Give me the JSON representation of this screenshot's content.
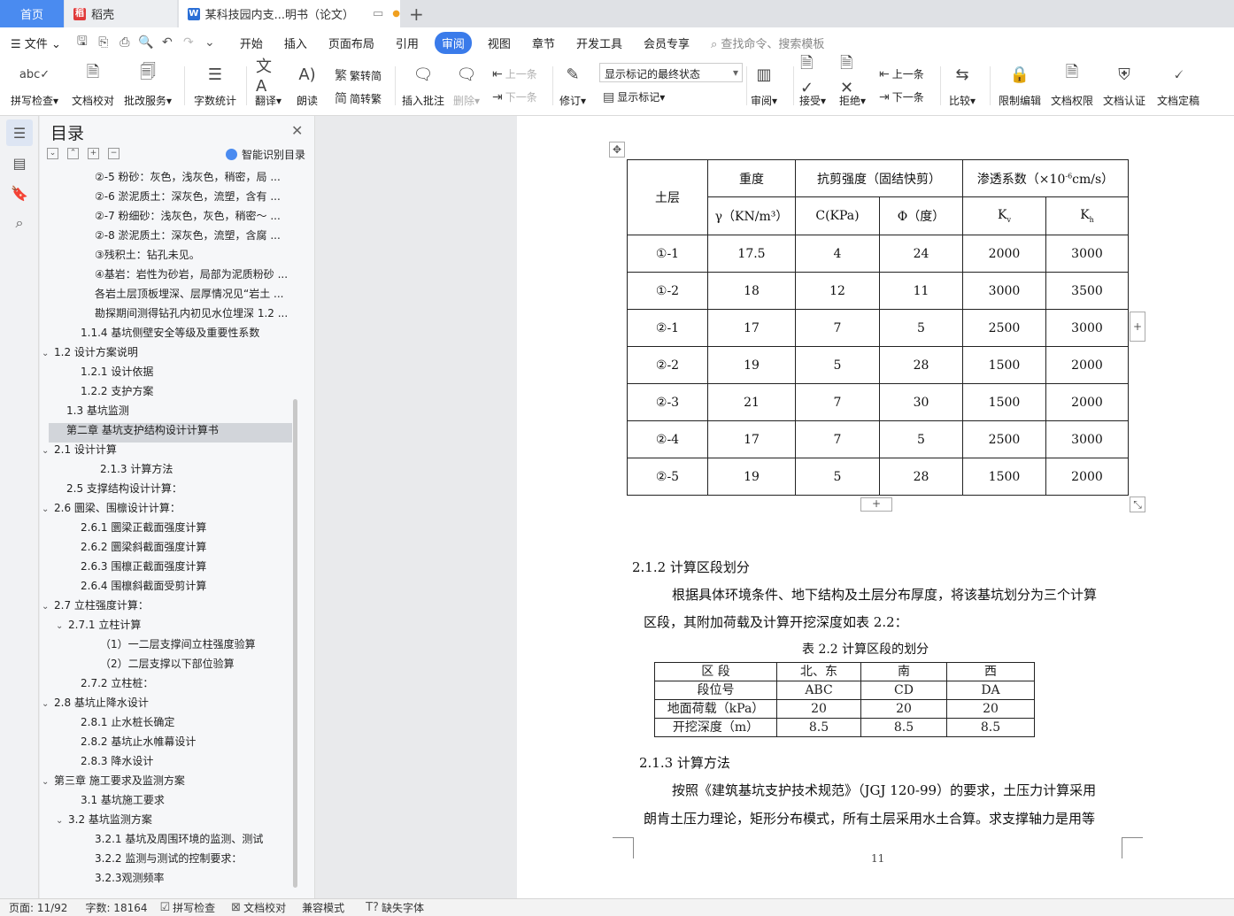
{
  "tabs": {
    "home": "首页",
    "daoke": "稻壳",
    "doc": "某科技园内支...明书（论文）"
  },
  "menubar": {
    "file": "文件",
    "items": [
      "开始",
      "插入",
      "页面布局",
      "引用",
      "审阅",
      "视图",
      "章节",
      "开发工具",
      "会员专享"
    ],
    "active": "审阅",
    "search": "查找命令、搜索模板"
  },
  "ribbon": {
    "spell": "拼写检查",
    "proof": "文档校对",
    "batch": "批改服务",
    "wordcount": "字数统计",
    "translate": "翻译",
    "read": "朗读",
    "t2s": "繁转简",
    "s2t": "简转繁",
    "insert_comment": "插入批注",
    "delete": "删除",
    "prev_comment": "上一条",
    "next_comment": "下一条",
    "revise": "修订",
    "mark_state": "显示标记的最终状态",
    "show_marks": "显示标记",
    "review": "审阅",
    "accept": "接受",
    "reject": "拒绝",
    "prev": "上一条",
    "next": "下一条",
    "compare": "比较",
    "restrict": "限制编辑",
    "rights": "文档权限",
    "auth": "文档认证",
    "finalize": "文档定稿"
  },
  "toc": {
    "title": "目录",
    "smart": "智能识别目录",
    "items": [
      {
        "text": "②-5 粉砂：灰色，浅灰色，稍密，局 ...",
        "caret": ""
      },
      {
        "text": "②-6 淤泥质土：深灰色，流塑，含有 ...",
        "caret": ""
      },
      {
        "text": "②-7 粉细砂：浅灰色，灰色，稍密～ ...",
        "caret": ""
      },
      {
        "text": "②-8 淤泥质土：深灰色，流塑，含腐 ...",
        "caret": ""
      },
      {
        "text": "③残积土：钻孔未见。",
        "caret": ""
      },
      {
        "text": "④基岩：岩性为砂岩，局部为泥质粉砂 ...",
        "caret": ""
      },
      {
        "text": "各岩土层顶板埋深、层厚情况见“岩土 ...",
        "caret": ""
      },
      {
        "text": "勘探期间测得钻孔内初见水位埋深 1.2 ...",
        "caret": ""
      },
      {
        "text": "1.1.4  基坑侧壁安全等级及重要性系数",
        "caret": ""
      },
      {
        "text": "1.2  设计方案说明",
        "caret": "v"
      },
      {
        "text": "1.2.1  设计依据",
        "caret": ""
      },
      {
        "text": "1.2.2  支护方案",
        "caret": ""
      },
      {
        "text": "1.3  基坑监测",
        "caret": ""
      },
      {
        "text": "第二章  基坑支护结构设计计算书",
        "caret": ""
      },
      {
        "text": "2.1  设计计算",
        "caret": "v"
      },
      {
        "text": "2.1.3 计算方法",
        "caret": ""
      },
      {
        "text": "2.5 支撑结构设计计算：",
        "caret": ""
      },
      {
        "text": "2.6 圜梁、围檩设计计算：",
        "caret": "v"
      },
      {
        "text": "2.6.1  圜梁正截面强度计算",
        "caret": ""
      },
      {
        "text": "2.6.2  圜梁斜截面强度计算",
        "caret": ""
      },
      {
        "text": "2.6.3  围檩正截面强度计算",
        "caret": ""
      },
      {
        "text": "2.6.4 围檩斜截面受剪计算",
        "caret": ""
      },
      {
        "text": "2.7 立柱强度计算：",
        "caret": "v"
      },
      {
        "text": "2.7.1 立柱计算",
        "caret": "v"
      },
      {
        "text": "（1）一二层支撑间立柱强度验算",
        "caret": ""
      },
      {
        "text": "（2）二层支撑以下部位验算",
        "caret": ""
      },
      {
        "text": "2.7.2 立柱桩：",
        "caret": ""
      },
      {
        "text": "2.8  基坑止降水设计",
        "caret": "v"
      },
      {
        "text": "2.8.1 止水桩长确定",
        "caret": ""
      },
      {
        "text": "2.8.2 基坑止水帷幕设计",
        "caret": ""
      },
      {
        "text": "2.8.3 降水设计",
        "caret": ""
      },
      {
        "text": "第三章    施工要求及监测方案",
        "caret": "v"
      },
      {
        "text": "3.1    基坑施工要求",
        "caret": ""
      },
      {
        "text": "3.2    基坑监测方案",
        "caret": "v"
      },
      {
        "text": "3.2.1 基坑及周围环境的监测、测试",
        "caret": ""
      },
      {
        "text": "3.2.2 监测与测试的控制要求：",
        "caret": ""
      },
      {
        "text": "3.2.3观测频率",
        "caret": ""
      }
    ]
  },
  "doc": {
    "table1": {
      "h_layer": "土层",
      "h_weight": "重度",
      "h_shear": "抗剪强度（固结快剪）",
      "h_perm_a": "渗透系数（×10",
      "h_perm_sup": "-6",
      "h_perm_b": "cm/s）",
      "h_gamma": "γ（KN/m³）",
      "h_c": "C(KPa)",
      "h_phi": "Φ（度）",
      "h_kv": "K",
      "h_kv_sub": "v",
      "h_kh": "K",
      "h_kh_sub": "h",
      "rows": [
        [
          "①-1",
          "17.5",
          "4",
          "24",
          "2000",
          "3000"
        ],
        [
          "①-2",
          "18",
          "12",
          "11",
          "3000",
          "3500"
        ],
        [
          "②-1",
          "17",
          "7",
          "5",
          "2500",
          "3000"
        ],
        [
          "②-2",
          "19",
          "5",
          "28",
          "1500",
          "2000"
        ],
        [
          "②-3",
          "21",
          "7",
          "30",
          "1500",
          "2000"
        ],
        [
          "②-4",
          "17",
          "7",
          "5",
          "2500",
          "3000"
        ],
        [
          "②-5",
          "19",
          "5",
          "28",
          "1500",
          "2000"
        ]
      ]
    },
    "section_212": "2.1.2 计算区段划分",
    "para1_line1": "根据具体环境条件、地下结构及土层分布厚度，将该基坑划分为三个计算",
    "para1_line2": "区段，其附加荷载及计算开挖深度如表 2.2：",
    "table2_caption": "表 2.2   计算区段的划分",
    "table2": {
      "rows": [
        [
          "区   段",
          "北、东",
          "南",
          "西"
        ],
        [
          "段位号",
          "ABC",
          "CD",
          "DA"
        ],
        [
          "地面荷载（kPa）",
          "20",
          "20",
          "20"
        ],
        [
          "开挖深度（m）",
          "8.5",
          "8.5",
          "8.5"
        ]
      ]
    },
    "section_213": "2.1.3 计算方法",
    "para2_line1": "按照《建筑基坑支护技术规范》（JGJ 120-99）的要求，土压力计算采用",
    "para2_line2": "朗肯土压力理论，矩形分布模式，所有土层采用水土合算。求支撑轴力是用等",
    "page_number": "11"
  },
  "status": {
    "page": "页面: 11/92",
    "words": "字数: 18164",
    "spell": "拼写检查",
    "proof": "文档校对",
    "compat": "兼容模式",
    "missing_font": "缺失字体"
  }
}
